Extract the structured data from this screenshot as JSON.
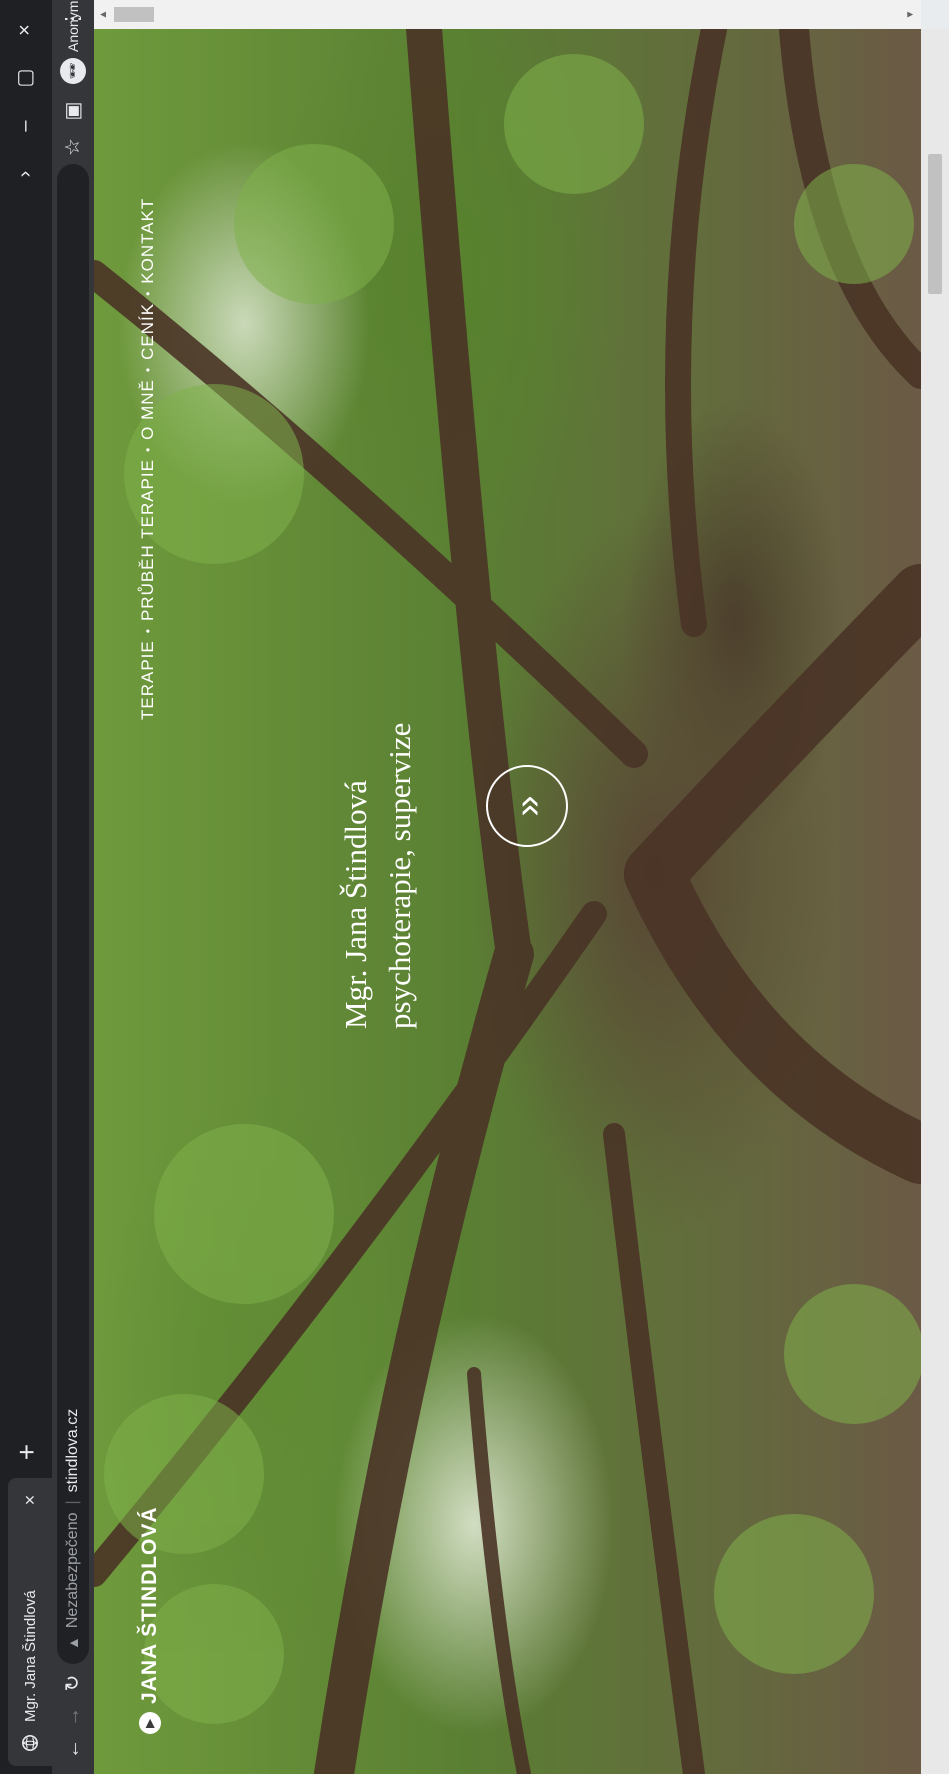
{
  "browser": {
    "tab": {
      "title": "Mgr. Jana Štindlová",
      "close_glyph": "×"
    },
    "new_tab_glyph": "+",
    "window_controls": {
      "chevron": "›",
      "minimize": "–",
      "restore": "▢",
      "close": "×"
    },
    "toolbar": {
      "back": "←",
      "forward": "→",
      "reload": "↻",
      "star": "☆",
      "menu": "⋮",
      "sidepanel": "▣"
    },
    "address": {
      "security": "Nezabezpečeno",
      "separator": "|",
      "host": "stindlova.cz",
      "warning_glyph": "▲"
    },
    "profile": {
      "label": "Anonymní",
      "avatar_glyph": "🕶"
    }
  },
  "site": {
    "brand": {
      "name": "JANA ŠTINDLOVÁ",
      "icon_glyph": "▶"
    },
    "nav": {
      "items": [
        "TERAPIE",
        "PRŮBĚH TERAPIE",
        "O MNĚ",
        "CENÍK",
        "KONTAKT"
      ],
      "separator": "•"
    },
    "hero": {
      "title": "Mgr. Jana Štindlová",
      "subtitle": "psychoterapie, supervize",
      "scroll_glyph": "»"
    }
  },
  "scrollbar": {
    "up": "▲",
    "down": "▼"
  },
  "colors": {
    "tabstrip": "#1f2023",
    "toolbar": "#35363a",
    "omnibox": "#202124",
    "hero_text": "#ffffff"
  }
}
